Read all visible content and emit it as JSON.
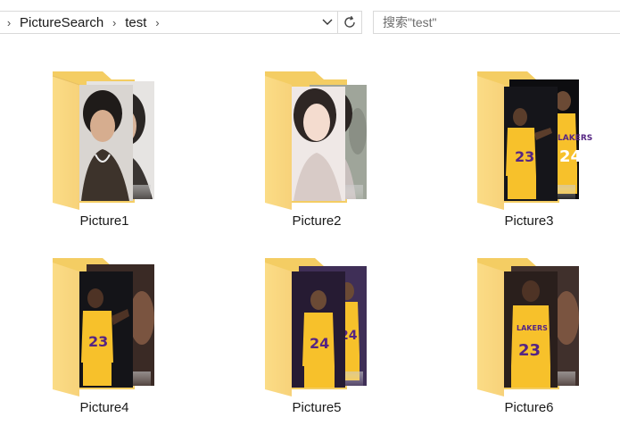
{
  "address_bar": {
    "crumbs": [
      "PictureSearch",
      "test"
    ]
  },
  "search": {
    "placeholder": "搜索\"test\""
  },
  "folders": [
    {
      "label": "Picture1"
    },
    {
      "label": "Picture2"
    },
    {
      "label": "Picture3"
    },
    {
      "label": "Picture4"
    },
    {
      "label": "Picture5"
    },
    {
      "label": "Picture6"
    }
  ],
  "colors": {
    "folder_back": "#F4CD63",
    "folder_front": "#FCE08E",
    "jersey_yellow": "#F7C12B",
    "jersey_purple": "#552583"
  },
  "icons": [
    "chevron-right-icon",
    "chevron-down-icon",
    "refresh-icon",
    "folder-icon"
  ]
}
